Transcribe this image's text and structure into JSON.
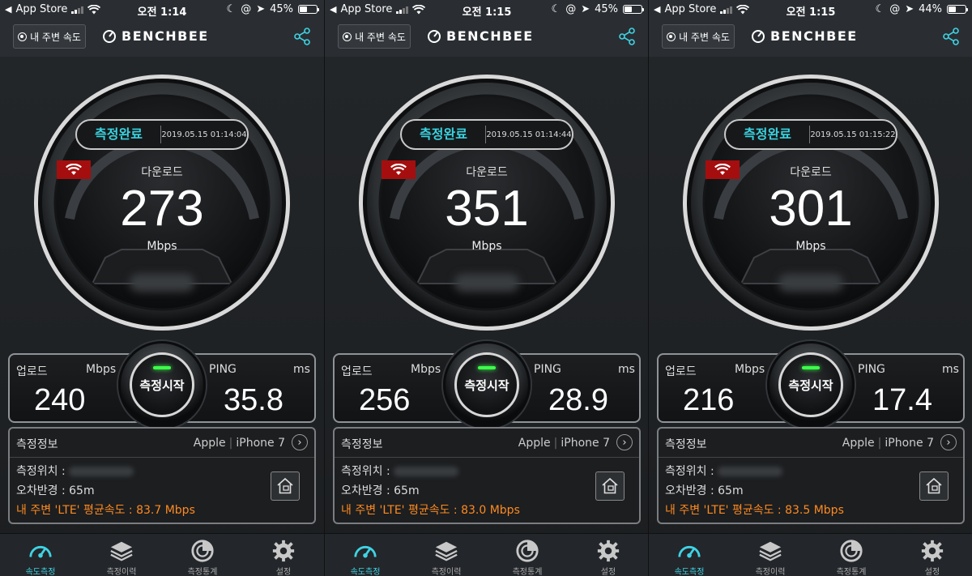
{
  "colors": {
    "accent": "#39d3e0",
    "record_badge": "#a50e0e",
    "avg_speed_text": "#ff8a1f",
    "start_led": "#3cff4a"
  },
  "screens": [
    {
      "status": {
        "back_app": "App Store",
        "time": "오전 1:14",
        "battery": "45%",
        "battery_level": 0.45
      },
      "header": {
        "near_button": "내 주변 속도",
        "logo": "BENCHBEE"
      },
      "result": {
        "status": "측정완료",
        "datetime": "2019.05.15 01:14:04",
        "download_label": "다운로드",
        "download_value": "273",
        "download_unit": "Mbps"
      },
      "stats": {
        "upload_label": "업로드",
        "upload_unit": "Mbps",
        "upload_value": "240",
        "ping_label": "PING",
        "ping_unit": "ms",
        "ping_value": "35.8",
        "start_button": "측정시작"
      },
      "info": {
        "title": "측정정보",
        "device_brand": "Apple",
        "device_model": "iPhone 7",
        "location_label": "측정위치 :",
        "radius_label": "오차반경 : 65m",
        "avg_speed": "내 주변 'LTE' 평균속도 : 83.7 Mbps"
      },
      "tabs": [
        {
          "label": "속도측정",
          "icon": "speedometer-icon"
        },
        {
          "label": "측정이력",
          "icon": "layers-icon"
        },
        {
          "label": "측정통계",
          "icon": "statistics-icon"
        },
        {
          "label": "설정",
          "icon": "gear-icon"
        }
      ]
    },
    {
      "status": {
        "back_app": "App Store",
        "time": "오전 1:15",
        "battery": "45%",
        "battery_level": 0.45
      },
      "header": {
        "near_button": "내 주변 속도",
        "logo": "BENCHBEE"
      },
      "result": {
        "status": "측정완료",
        "datetime": "2019.05.15 01:14:44",
        "download_label": "다운로드",
        "download_value": "351",
        "download_unit": "Mbps"
      },
      "stats": {
        "upload_label": "업로드",
        "upload_unit": "Mbps",
        "upload_value": "256",
        "ping_label": "PING",
        "ping_unit": "ms",
        "ping_value": "28.9",
        "start_button": "측정시작"
      },
      "info": {
        "title": "측정정보",
        "device_brand": "Apple",
        "device_model": "iPhone 7",
        "location_label": "측정위치 :",
        "radius_label": "오차반경 : 65m",
        "avg_speed": "내 주변 'LTE' 평균속도 : 83.0 Mbps"
      },
      "tabs": [
        {
          "label": "속도측정",
          "icon": "speedometer-icon"
        },
        {
          "label": "측정이력",
          "icon": "layers-icon"
        },
        {
          "label": "측정통계",
          "icon": "statistics-icon"
        },
        {
          "label": "설정",
          "icon": "gear-icon"
        }
      ]
    },
    {
      "status": {
        "back_app": "App Store",
        "time": "오전 1:15",
        "battery": "44%",
        "battery_level": 0.44
      },
      "header": {
        "near_button": "내 주변 속도",
        "logo": "BENCHBEE"
      },
      "result": {
        "status": "측정완료",
        "datetime": "2019.05.15 01:15:22",
        "download_label": "다운로드",
        "download_value": "301",
        "download_unit": "Mbps"
      },
      "stats": {
        "upload_label": "업로드",
        "upload_unit": "Mbps",
        "upload_value": "216",
        "ping_label": "PING",
        "ping_unit": "ms",
        "ping_value": "17.4",
        "start_button": "측정시작"
      },
      "info": {
        "title": "측정정보",
        "device_brand": "Apple",
        "device_model": "iPhone 7",
        "location_label": "측정위치 :",
        "radius_label": "오차반경 : 65m",
        "avg_speed": "내 주변 'LTE' 평균속도 : 83.5 Mbps"
      },
      "tabs": [
        {
          "label": "속도측정",
          "icon": "speedometer-icon"
        },
        {
          "label": "측정이력",
          "icon": "layers-icon"
        },
        {
          "label": "측정통계",
          "icon": "statistics-icon"
        },
        {
          "label": "설정",
          "icon": "gear-icon"
        }
      ]
    }
  ]
}
